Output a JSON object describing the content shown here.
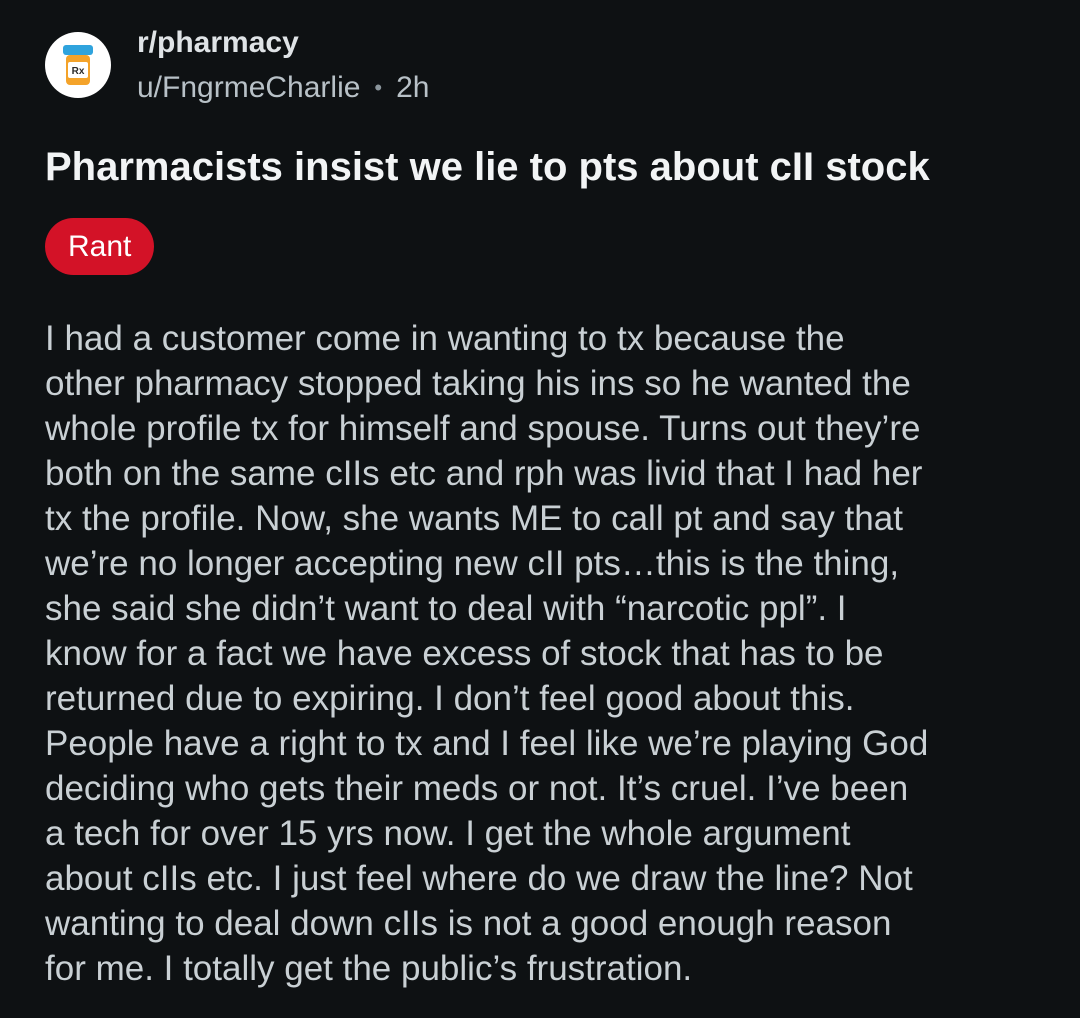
{
  "post": {
    "subreddit": "r/pharmacy",
    "username": "u/FngrmeCharlie",
    "separator": "•",
    "time_ago": "2h",
    "avatar_icon": "pill-bottle-rx-icon",
    "title": "Pharmacists insist we lie to pts about cII stock",
    "flair": "Rant",
    "flair_color": "#d31227",
    "body_lines": [
      "I had a customer come in wanting to tx because the",
      "other pharmacy stopped taking his ins so he wanted the",
      "whole profile tx for himself and spouse. Turns out they’re",
      "both on the same cIIs etc and rph was livid that I had her",
      "tx the profile. Now, she wants ME to call pt and say that",
      "we’re no longer accepting new cII pts…this is the thing,",
      "she said she didn’t want to deal with “narcotic ppl”. I",
      "know for a fact we have excess of stock that has to be",
      "returned due to expiring. I don’t feel good about this.",
      "People have a right to tx and I feel like we’re playing God",
      "deciding who gets their meds or not. It’s cruel. I’ve been",
      "a tech for over 15 yrs now. I get the whole argument",
      "about cIIs etc. I just feel where do we draw the line? Not",
      "wanting to deal down cIIs is not a good enough reason",
      "for me. I totally get the public’s frustration."
    ]
  }
}
